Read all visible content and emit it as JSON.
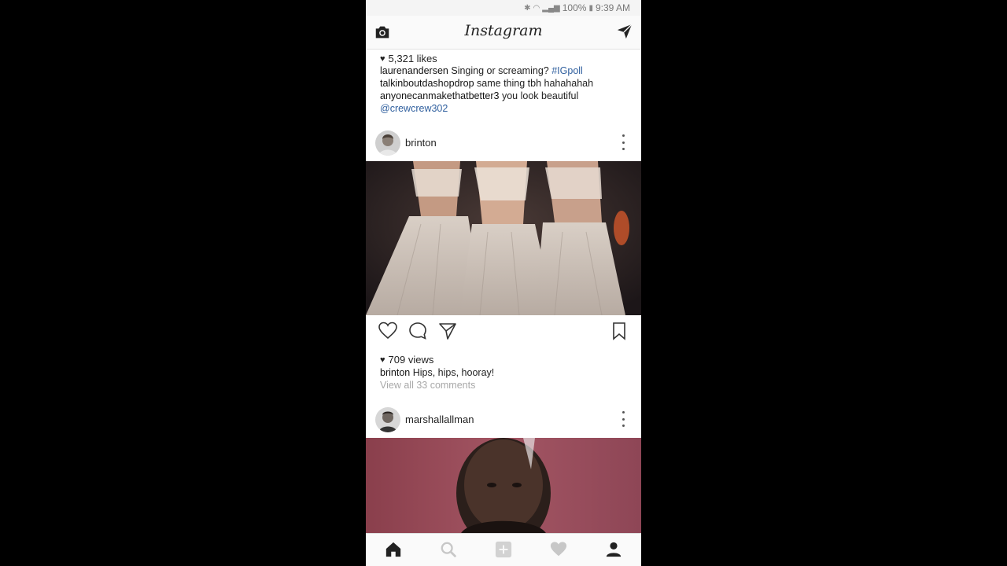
{
  "status": {
    "battery": "100%",
    "time": "9:39 AM"
  },
  "header": {
    "logo": "Instagram",
    "camera_icon": "camera-icon",
    "direct_icon": "direct-send-icon"
  },
  "post1": {
    "likes": "5,321 likes",
    "caption_user": "laurenandersen",
    "caption_text": "Singing or screaming?",
    "caption_tag": "#IGpoll",
    "comments": [
      {
        "user": "talkinboutdashopdrop",
        "text": "same thing tbh hahahahah"
      },
      {
        "user": "anyonecanmakethatbetter3",
        "text": "you look beautiful"
      }
    ],
    "mention": "@crewcrew302"
  },
  "post2": {
    "username": "brinton",
    "views": "709 views",
    "caption_user": "brinton",
    "caption_text": "Hips, hips, hooray!",
    "view_comments": "View all 33 comments"
  },
  "post3": {
    "username": "marshallallman"
  },
  "navbar": {
    "items": [
      "home-icon",
      "search-icon",
      "add-icon",
      "heart-icon",
      "profile-icon"
    ]
  }
}
